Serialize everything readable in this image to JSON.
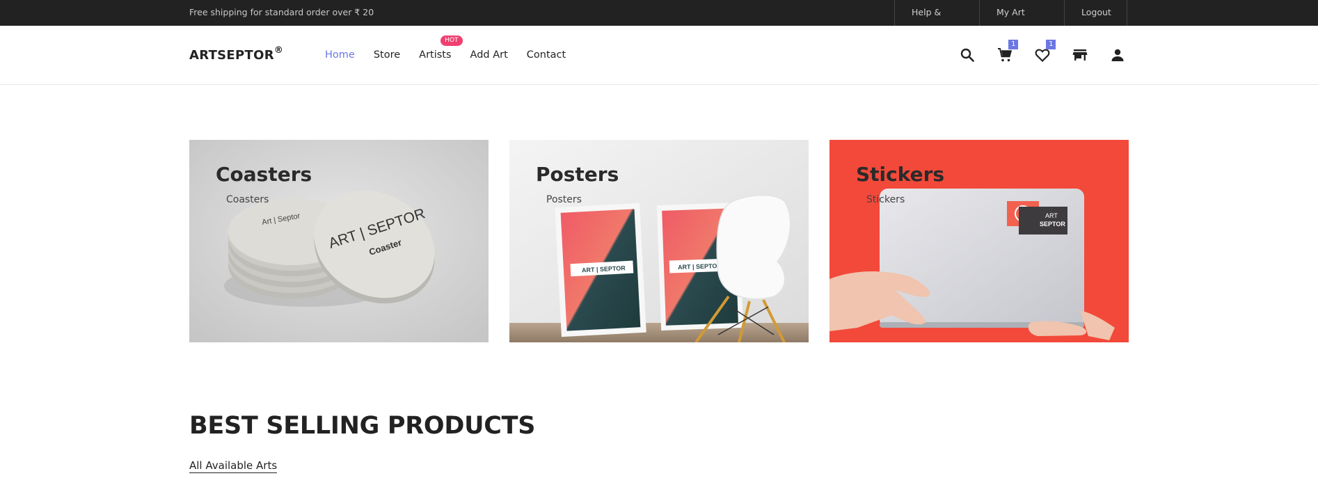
{
  "topbar": {
    "promo": "Free shipping for standard order over ₹ 20",
    "links": [
      "Help & FAQs",
      "My Art Store",
      "Logout"
    ]
  },
  "header": {
    "brand": "ARTSEPTOR",
    "brand_mark": "®",
    "nav": [
      {
        "label": "Home",
        "active": true
      },
      {
        "label": "Store",
        "active": false
      },
      {
        "label": "Artists",
        "active": false,
        "badge": "HOT"
      },
      {
        "label": "Add Art",
        "active": false
      },
      {
        "label": "Contact",
        "active": false
      }
    ],
    "icons": [
      "search-icon",
      "cart-icon",
      "heart-icon",
      "store-icon",
      "user-icon"
    ],
    "cart_count": "1",
    "wishlist_count": "1",
    "accent_color": "#6b77e5",
    "hot_color": "#f0406f"
  },
  "categories": [
    {
      "title": "Coasters",
      "subtitle": "Coasters",
      "bg": "#d2d2d2",
      "coaster_text": "ART | SEPTOR",
      "coaster_sub": "Coaster",
      "stack_text": "Art | Septor"
    },
    {
      "title": "Posters",
      "subtitle": "Posters",
      "bg": "#ebebeb",
      "poster_text": "ART | SEPTOR"
    },
    {
      "title": "Stickers",
      "subtitle": "Stickers",
      "bg": "#f2493a",
      "sticker_text_1": "ART",
      "sticker_text_2": "SEPTOR"
    }
  ],
  "best_selling": {
    "title": "BEST SELLING PRODUCTS",
    "link": "All Available Arts"
  }
}
